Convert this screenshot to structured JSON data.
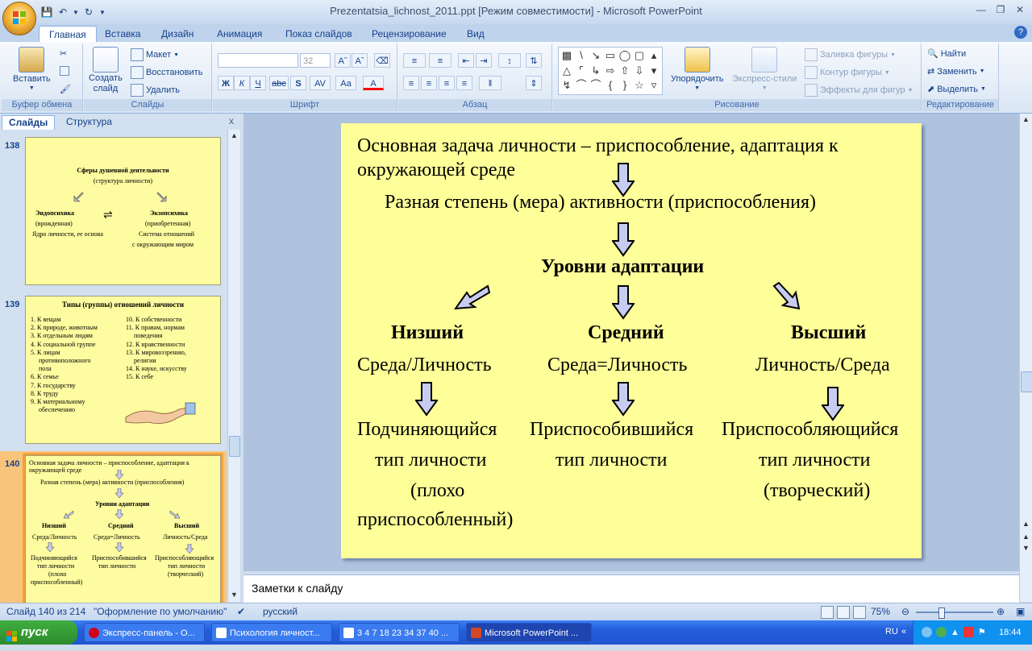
{
  "window": {
    "title": "Prezentatsia_lichnost_2011.ppt [Режим совместимости] - Microsoft PowerPoint",
    "controls": [
      "minimize-icon",
      "restore-icon",
      "close-icon"
    ]
  },
  "ribbon": {
    "tabs": [
      "Главная",
      "Вставка",
      "Дизайн",
      "Анимация",
      "Показ слайдов",
      "Рецензирование",
      "Вид"
    ],
    "active_tab": "Главная",
    "clipboard": {
      "label": "Буфер обмена",
      "paste": "Вставить"
    },
    "slides": {
      "label": "Слайды",
      "create": "Создать",
      "create2": "слайд",
      "layout": "Макет",
      "reset": "Восстановить",
      "delete": "Удалить"
    },
    "font": {
      "label": "Шрифт",
      "size": "32",
      "bold": "Ж",
      "italic": "К",
      "underline": "Ч",
      "strike": "abc",
      "shadow": "S",
      "spacing": "AV",
      "case": "Aa",
      "color": "A"
    },
    "paragraph": {
      "label": "Абзац"
    },
    "drawing": {
      "label": "Рисование",
      "arrange": "Упорядочить",
      "styles": "Экспресс-стили",
      "fill": "Заливка фигуры",
      "outline": "Контур фигуры",
      "effects": "Эффекты для фигур"
    },
    "editing": {
      "label": "Редактирование",
      "find": "Найти",
      "replace": "Заменить",
      "select": "Выделить"
    }
  },
  "panel": {
    "tabs": [
      "Слайды",
      "Структура"
    ],
    "close": "x",
    "thumbs": [
      {
        "num": "138",
        "title": "Сферы душевной деятельности",
        "subtitle": "(структура личности)",
        "left_h": "Эндопсихика",
        "left_1": "(врожденная)",
        "left_2": "Ядро личности, ее основа",
        "right_h": "Экзопсихика",
        "right_1": "(приобретенная)",
        "right_2": "Система отношений",
        "right_3": "с окружающим миром"
      },
      {
        "num": "139",
        "title": "Типы (группы) отношений личности",
        "left": [
          "1. К вещам",
          "2. К природе, животным",
          "3. К отдельным людям",
          "4. К социальной группе",
          "5. К лицам",
          "противоположного",
          "пола",
          "6. К семье",
          "7. К государству",
          "8. К труду",
          "9. К материальному",
          "обеспечению"
        ],
        "right": [
          "10. К собственности",
          "11. К правам, нормам",
          "поведения",
          "12. К нравственности",
          "13. К мировоззрению,",
          "религии",
          "14. К науке, искусству",
          "15. К себе"
        ]
      },
      {
        "num": "140",
        "lines": [
          "Основная задача личности – приспособление, адаптация к",
          "окружающей среде",
          "Разная степень (мера) активности (приспособления)",
          "Уровни адаптации",
          "Низший",
          "Средний",
          "Высший",
          "Среда/Личность",
          "Среда=Личность",
          "Личность/Среда",
          "Подчиняющийся",
          "тип личности",
          "(плохо",
          "приспособленный)",
          "Приспособившийся",
          "тип личности",
          "Приспособляющийся",
          "тип личности",
          "(творческий)"
        ]
      }
    ]
  },
  "slide": {
    "line1": "Основная задача личности – приспособление, адаптация к",
    "line2": "окружающей среде",
    "line3": "Разная степень (мера)  активности (приспособления)",
    "heading": "Уровни адаптации",
    "levels": [
      {
        "name": "Низший",
        "relation": "Среда/Личность",
        "type1": "Подчиняющийся",
        "type2": "тип  личности",
        "type3": "(плохо",
        "type4": "приспособленный)"
      },
      {
        "name": "Средний",
        "relation": "Среда=Личность",
        "type1": "Приспособившийся",
        "type2": "тип    личности"
      },
      {
        "name": "Высший",
        "relation": "Личность/Среда",
        "type1": "Приспособляющийся",
        "type2": "тип личности",
        "type3": "(творческий)"
      }
    ]
  },
  "notes": {
    "placeholder": "Заметки к слайду"
  },
  "status": {
    "slide": "Слайд 140 из 214",
    "theme": "\"Оформление по умолчанию\"",
    "lang": "русский",
    "zoom": "75%"
  },
  "taskbar": {
    "start": "пуск",
    "tasks": [
      "Экспресс-панель - О...",
      "Психология личност...",
      "3 4 7 18 23 34 37 40 ...",
      "Microsoft PowerPoint ..."
    ],
    "lang": "RU",
    "time": "18:44"
  },
  "colors": {
    "slide_bg": "#ffff99",
    "arrow_fill": "#c8ccf0",
    "selection": "#f2a13a"
  }
}
